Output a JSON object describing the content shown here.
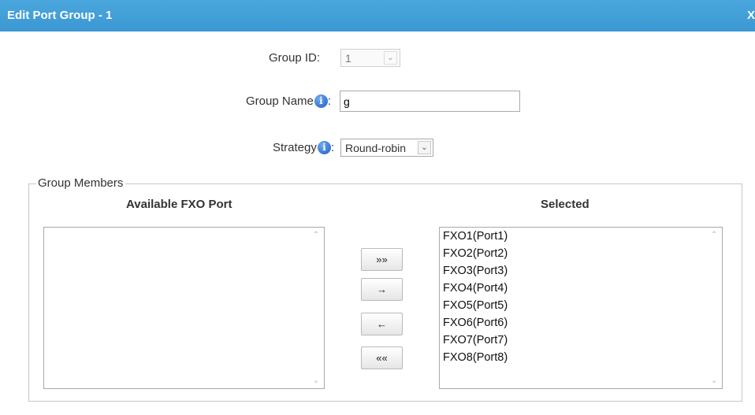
{
  "dialog": {
    "title": "Edit Port Group - 1",
    "close_label": "X"
  },
  "form": {
    "group_id": {
      "label": "Group ID",
      "value": "1"
    },
    "group_name": {
      "label": "Group Name",
      "value": "g"
    },
    "strategy": {
      "label": "Strategy",
      "value": "Round-robin"
    },
    "colon": ":"
  },
  "members": {
    "legend": "Group Members",
    "available_header": "Available FXO Port",
    "selected_header": "Selected",
    "available": [],
    "selected": [
      "FXO1(Port1)",
      "FXO2(Port2)",
      "FXO3(Port3)",
      "FXO4(Port4)",
      "FXO5(Port5)",
      "FXO6(Port6)",
      "FXO7(Port7)",
      "FXO8(Port8)"
    ],
    "buttons": {
      "add_all": "»»",
      "add": "→",
      "remove": "←",
      "remove_all": "««"
    }
  },
  "icons": {
    "info": "info-icon",
    "dropdown": "chevron-down-icon",
    "scroll_up": "caret-up-icon",
    "scroll_down": "caret-down-icon"
  },
  "colors": {
    "titlebar": "#3b97d2",
    "title_text": "#ffffff"
  }
}
